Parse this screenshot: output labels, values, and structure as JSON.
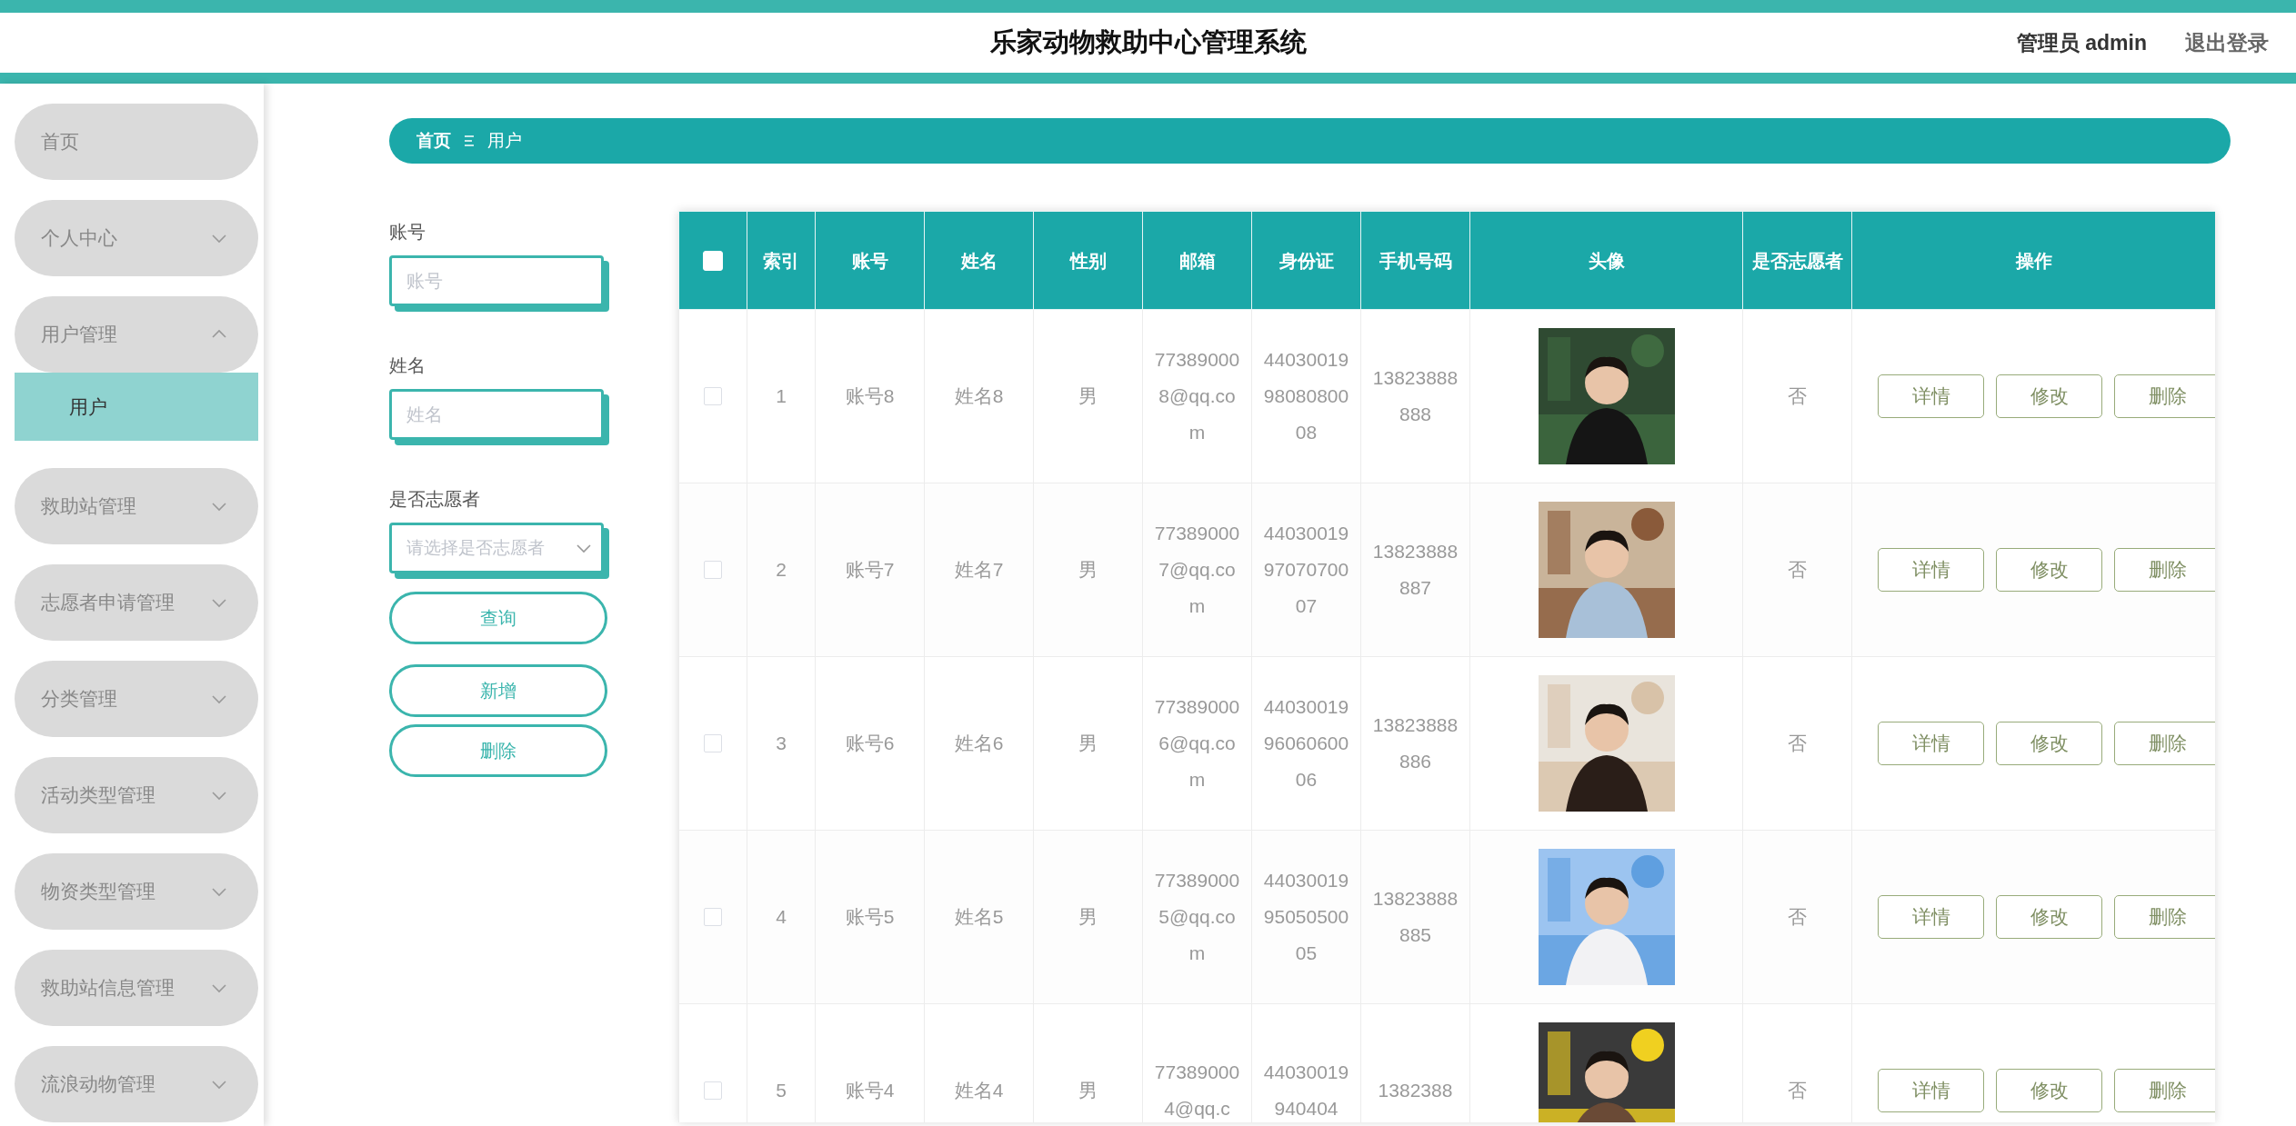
{
  "header": {
    "title": "乐家动物救助中心管理系统",
    "user": "管理员 admin",
    "logout": "退出登录"
  },
  "sidebar": {
    "items": [
      {
        "label": "首页",
        "kind": "link"
      },
      {
        "label": "个人中心",
        "kind": "menu",
        "expanded": false
      },
      {
        "label": "用户管理",
        "kind": "menu",
        "expanded": true,
        "children": [
          {
            "label": "用户",
            "selected": true
          }
        ]
      },
      {
        "label": "救助站管理",
        "kind": "menu",
        "expanded": false
      },
      {
        "label": "志愿者申请管理",
        "kind": "menu",
        "expanded": false
      },
      {
        "label": "分类管理",
        "kind": "menu",
        "expanded": false
      },
      {
        "label": "活动类型管理",
        "kind": "menu",
        "expanded": false
      },
      {
        "label": "物资类型管理",
        "kind": "menu",
        "expanded": false
      },
      {
        "label": "救助站信息管理",
        "kind": "menu",
        "expanded": false
      },
      {
        "label": "流浪动物管理",
        "kind": "menu",
        "expanded": false
      }
    ]
  },
  "breadcrumb": [
    "首页",
    "用户"
  ],
  "search": {
    "fields": [
      {
        "label": "账号",
        "kind": "input",
        "placeholder": "账号"
      },
      {
        "label": "姓名",
        "kind": "input",
        "placeholder": "姓名"
      },
      {
        "label": "是否志愿者",
        "kind": "select",
        "placeholder": "请选择是否志愿者"
      }
    ],
    "buttons": [
      "查询",
      "新增",
      "删除"
    ]
  },
  "table": {
    "select_all": {
      "checked": false
    },
    "columns": [
      "索引",
      "账号",
      "姓名",
      "性别",
      "邮箱",
      "身份证",
      "手机号码",
      "头像",
      "是否志愿者",
      "操作"
    ],
    "rows": [
      {
        "checked": false,
        "index": "1",
        "account": "账号8",
        "name": "姓名8",
        "gender": "男",
        "email": "773890008@qq.com",
        "id_card": "440300199808080008",
        "phone": "13823888888",
        "volunteer": "否",
        "actions": [
          "详情",
          "修改",
          "删除"
        ]
      },
      {
        "checked": false,
        "index": "2",
        "account": "账号7",
        "name": "姓名7",
        "gender": "男",
        "email": "773890007@qq.com",
        "id_card": "440300199707070007",
        "phone": "13823888887",
        "volunteer": "否",
        "actions": [
          "详情",
          "修改",
          "删除"
        ]
      },
      {
        "checked": false,
        "index": "3",
        "account": "账号6",
        "name": "姓名6",
        "gender": "男",
        "email": "773890006@qq.com",
        "id_card": "440300199606060006",
        "phone": "13823888886",
        "volunteer": "否",
        "actions": [
          "详情",
          "修改",
          "删除"
        ]
      },
      {
        "checked": false,
        "index": "4",
        "account": "账号5",
        "name": "姓名5",
        "gender": "男",
        "email": "773890005@qq.com",
        "id_card": "440300199505050005",
        "phone": "13823888885",
        "volunteer": "否",
        "actions": [
          "详情",
          "修改",
          "删除"
        ]
      },
      {
        "checked": false,
        "index": "5",
        "account": "账号4",
        "name": "姓名4",
        "gender": "男",
        "email": "773890004@qq.c",
        "id_card": "44030019940404",
        "phone": "1382388",
        "volunteer": "否",
        "actions": [
          "详情",
          "修改",
          "删除"
        ]
      }
    ]
  }
}
